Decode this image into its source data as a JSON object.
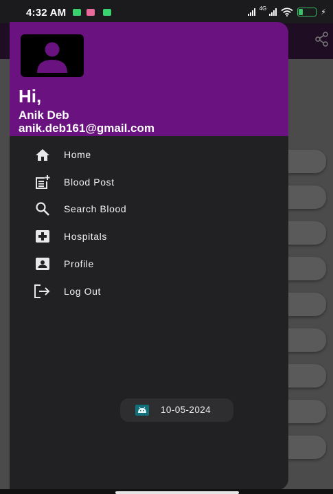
{
  "status_bar": {
    "time": "4:32 AM",
    "network": "4G",
    "battery": "27",
    "battery_level": 0.27,
    "colors": {
      "battery": "#38c26a",
      "app_icon_green": "#3bd16f",
      "app_icon_pink": "#e86a9a"
    }
  },
  "drawer": {
    "header": {
      "greeting": "Hi,",
      "name": "Anik Deb",
      "email": "anik.deb161@gmail.com",
      "avatar_icon": "person-icon",
      "background_color": "#6a1380"
    },
    "menu": [
      {
        "label": "Home",
        "icon": "home-icon"
      },
      {
        "label": "Blood Post",
        "icon": "post-add-icon"
      },
      {
        "label": "Search Blood",
        "icon": "search-icon"
      },
      {
        "label": "Hospitals",
        "icon": "hospital-icon"
      },
      {
        "label": "Profile",
        "icon": "profile-card-icon"
      },
      {
        "label": "Log Out",
        "icon": "logout-icon"
      }
    ],
    "footer": {
      "date": "10-05-2024",
      "icon": "android-icon"
    }
  },
  "background_app": {
    "toolbar_icon": "share-icon"
  }
}
